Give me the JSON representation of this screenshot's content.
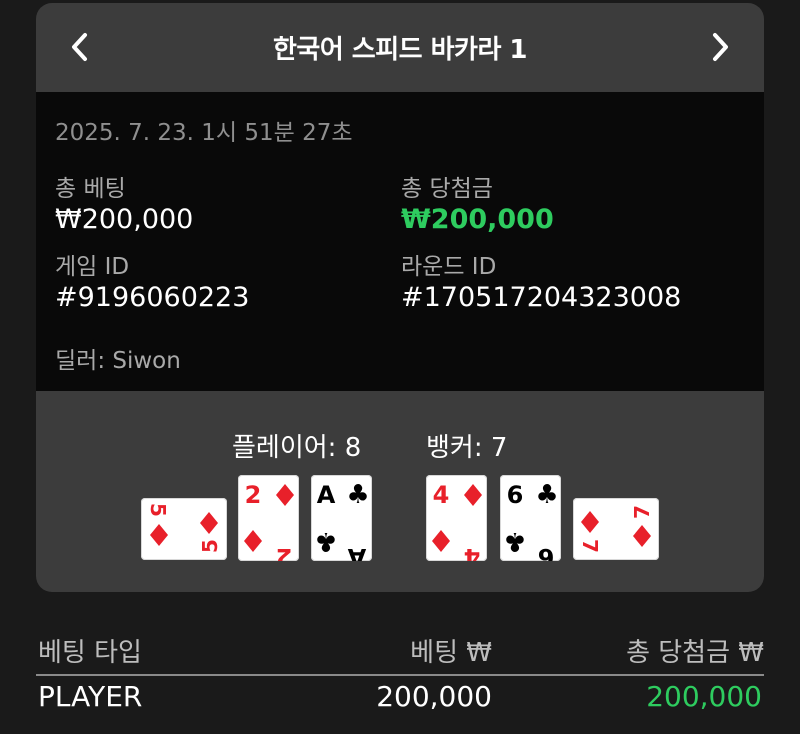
{
  "header": {
    "title": "한국어 스피드 바카라 1",
    "prev_icon": "chevron-left-icon",
    "next_icon": "chevron-right-icon"
  },
  "info": {
    "timestamp": "2025. 7. 23. 1시 51분 27초",
    "total_bet_label": "총 베팅",
    "total_bet_value": "₩200,000",
    "total_win_label": "총 당첨금",
    "total_win_value": "₩200,000",
    "game_id_label": "게임 ID",
    "game_id_value": "#9196060223",
    "round_id_label": "라운드 ID",
    "round_id_value": "#170517204323008",
    "dealer": "딜러: Siwon"
  },
  "result": {
    "player_label": "플레이어: 8",
    "banker_label": "뱅커: 7",
    "player_cards": [
      {
        "rank": "5",
        "suit": "diamond",
        "orientation": "sideways"
      },
      {
        "rank": "2",
        "suit": "diamond",
        "orientation": "upright"
      },
      {
        "rank": "A",
        "suit": "club",
        "orientation": "upright"
      }
    ],
    "banker_cards": [
      {
        "rank": "4",
        "suit": "diamond",
        "orientation": "upright"
      },
      {
        "rank": "6",
        "suit": "club",
        "orientation": "upright"
      },
      {
        "rank": "7",
        "suit": "diamond",
        "orientation": "sideways"
      }
    ]
  },
  "bets_table": {
    "headers": [
      "베팅 타입",
      "베팅 ₩",
      "총 당첨금 ₩"
    ],
    "rows": [
      {
        "type": "PLAYER",
        "bet": "200,000",
        "win": "200,000"
      }
    ]
  },
  "colors": {
    "win_green": "#2ecc5f",
    "diamond_red": "#e8202a",
    "club_black": "#000000",
    "panel": "#3c3c3c",
    "info_bg": "#090909"
  }
}
